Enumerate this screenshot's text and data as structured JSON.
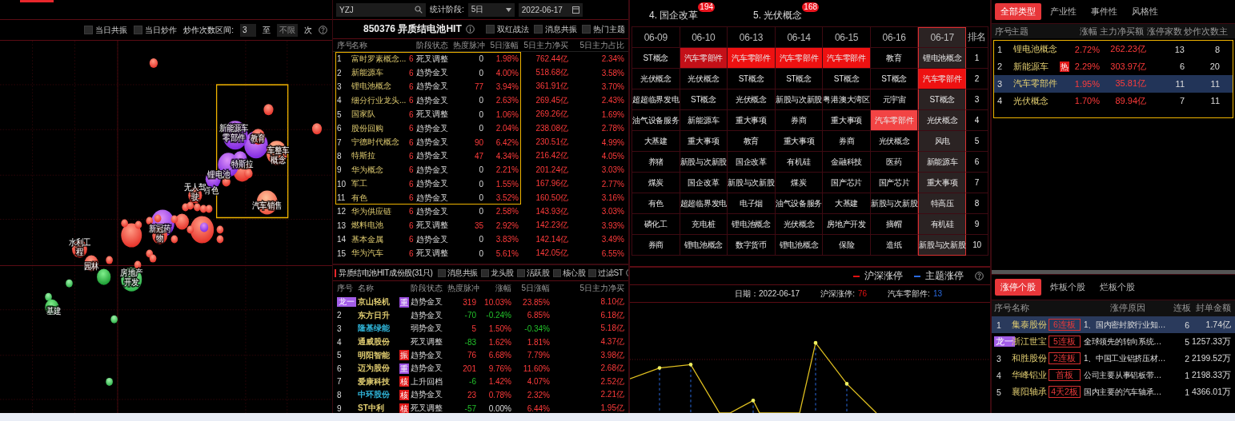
{
  "bubble_panel": {
    "options": [
      {
        "label": "当日共振",
        "checked": false
      },
      {
        "label": "当日炒作",
        "checked": false
      }
    ],
    "range_label": "炒作次数区间:",
    "range_from": "3",
    "range_sep": "至",
    "range_to_placeholder": "不限",
    "range_unit": "次",
    "bubble_labels": [
      "新能源车零部件",
      "教育",
      "车整车概念",
      "特斯拉",
      "锂电池",
      "有色",
      "汽车销售",
      "无人驾驶",
      "新冠药物",
      "水利工程",
      "园林",
      "房地产开发",
      "基建"
    ]
  },
  "toolbar": {
    "search": "YZJ",
    "period_label": "统计阶段:",
    "period": "5日",
    "date": "2022-06-17"
  },
  "theme_table": {
    "title": "850376 异质结电池HIT",
    "options": [
      {
        "label": "双红战法",
        "checked": false
      },
      {
        "label": "消息共振",
        "checked": false
      },
      {
        "label": "热门主题",
        "checked": false
      }
    ],
    "columns": [
      "序号",
      "名称",
      "阶段状态",
      "热度脉冲",
      "5日涨幅",
      "5日主力净买",
      "5日主力占比"
    ],
    "rows": [
      {
        "no": "1",
        "name": "富时罗素概念...",
        "count": "6",
        "stage": "死叉调整",
        "heat": "0",
        "change_5d": "1.98%",
        "net_buy_5d": "762.44亿",
        "ratio_5d": "2.34%",
        "framed": true
      },
      {
        "no": "2",
        "name": "新能源车",
        "count": "6",
        "stage": "趋势金叉",
        "heat": "0",
        "change_5d": "4.00%",
        "net_buy_5d": "518.68亿",
        "ratio_5d": "3.58%",
        "framed": true
      },
      {
        "no": "3",
        "name": "锂电池概念",
        "count": "6",
        "stage": "趋势金叉",
        "heat": "77",
        "change_5d": "3.94%",
        "net_buy_5d": "361.91亿",
        "ratio_5d": "3.70%",
        "framed": true
      },
      {
        "no": "4",
        "name": "细分行业龙头...",
        "count": "6",
        "stage": "趋势金叉",
        "heat": "0",
        "change_5d": "2.63%",
        "net_buy_5d": "269.45亿",
        "ratio_5d": "2.43%",
        "framed": true
      },
      {
        "no": "5",
        "name": "国家队",
        "count": "6",
        "stage": "死叉调整",
        "heat": "0",
        "change_5d": "1.06%",
        "net_buy_5d": "269.26亿",
        "ratio_5d": "1.69%",
        "framed": true
      },
      {
        "no": "6",
        "name": "股份回购",
        "count": "6",
        "stage": "趋势金叉",
        "heat": "0",
        "change_5d": "2.04%",
        "net_buy_5d": "238.08亿",
        "ratio_5d": "2.78%",
        "framed": true
      },
      {
        "no": "7",
        "name": "宁德时代概念",
        "count": "6",
        "stage": "趋势金叉",
        "heat": "90",
        "change_5d": "6.42%",
        "net_buy_5d": "230.51亿",
        "ratio_5d": "4.99%",
        "framed": true
      },
      {
        "no": "8",
        "name": "特斯拉",
        "count": "6",
        "stage": "趋势金叉",
        "heat": "47",
        "change_5d": "4.34%",
        "net_buy_5d": "216.42亿",
        "ratio_5d": "4.05%",
        "framed": true
      },
      {
        "no": "9",
        "name": "华为概念",
        "count": "6",
        "stage": "趋势金叉",
        "heat": "0",
        "change_5d": "2.21%",
        "net_buy_5d": "201.24亿",
        "ratio_5d": "3.03%",
        "framed": true
      },
      {
        "no": "10",
        "name": "军工",
        "count": "6",
        "stage": "趋势金叉",
        "heat": "0",
        "change_5d": "1.55%",
        "net_buy_5d": "167.96亿",
        "ratio_5d": "2.77%",
        "framed": true
      },
      {
        "no": "11",
        "name": "有色",
        "count": "6",
        "stage": "趋势金叉",
        "heat": "0",
        "change_5d": "3.52%",
        "net_buy_5d": "160.50亿",
        "ratio_5d": "3.16%",
        "framed": true
      },
      {
        "no": "12",
        "name": "华为供应链",
        "count": "6",
        "stage": "趋势金叉",
        "heat": "0",
        "change_5d": "2.58%",
        "net_buy_5d": "143.93亿",
        "ratio_5d": "3.03%",
        "framed": false
      },
      {
        "no": "13",
        "name": "燃料电池",
        "count": "6",
        "stage": "死叉调整",
        "heat": "35",
        "change_5d": "2.92%",
        "net_buy_5d": "142.23亿",
        "ratio_5d": "3.93%",
        "framed": false
      },
      {
        "no": "14",
        "name": "基本金属",
        "count": "6",
        "stage": "趋势金叉",
        "heat": "0",
        "change_5d": "3.83%",
        "net_buy_5d": "142.14亿",
        "ratio_5d": "3.49%",
        "framed": false
      },
      {
        "no": "15",
        "name": "华为汽车",
        "count": "6",
        "stage": "死叉调整",
        "heat": "0",
        "change_5d": "5.61%",
        "net_buy_5d": "142.05亿",
        "ratio_5d": "6.55%",
        "framed": false
      }
    ]
  },
  "component_table": {
    "title": "异质结电池HIT成份股(31只)",
    "options": [
      {
        "label": "消息共振",
        "checked": false
      },
      {
        "label": "龙头股",
        "checked": false
      },
      {
        "label": "活跃股",
        "checked": false
      },
      {
        "label": "核心股",
        "checked": false
      },
      {
        "label": "过滤ST",
        "checked": false
      }
    ],
    "columns": [
      "序号",
      "名称",
      "阶段状态",
      "热度脉冲",
      "涨幅",
      "5日涨幅",
      "5日主力净买"
    ],
    "rows": [
      {
        "no": "龙一",
        "kind": "badge",
        "name": "京山轻机",
        "color": "#e0cc70",
        "tag": {
          "text": "重",
          "color": "#9b4de0"
        },
        "stage": "趋势金叉",
        "heat": "319",
        "change": "10.03%",
        "change_5d": "23.85%",
        "net_buy_5d": "8.10亿"
      },
      {
        "no": "2",
        "kind": "plain",
        "name": "东方日升",
        "color": "#e0cc70",
        "stage": "趋势金叉",
        "heat": "-70",
        "change": "-0.24%",
        "change_5d": "6.85%",
        "net_buy_5d": "6.18亿"
      },
      {
        "no": "3",
        "kind": "plain",
        "name": "隆基绿能",
        "color": "#2fb4d8",
        "stage": "弱势金叉",
        "heat": "5",
        "change": "1.50%",
        "change_5d": "-0.34%",
        "net_buy_5d": "5.18亿"
      },
      {
        "no": "4",
        "kind": "plain",
        "name": "通威股份",
        "color": "#e0cc70",
        "stage": "死叉调整",
        "heat": "-83",
        "change": "1.62%",
        "change_5d": "1.81%",
        "net_buy_5d": "4.37亿"
      },
      {
        "no": "5",
        "kind": "plain",
        "name": "明阳智能",
        "color": "#e0cc70",
        "tag": {
          "text": "振",
          "color": "#e01818"
        },
        "stage": "趋势金叉",
        "heat": "76",
        "change": "6.68%",
        "change_5d": "7.79%",
        "net_buy_5d": "3.98亿"
      },
      {
        "no": "6",
        "kind": "plain",
        "name": "迈为股份",
        "color": "#e0cc70",
        "tag": {
          "text": "重",
          "color": "#9b4de0"
        },
        "stage": "趋势金叉",
        "heat": "201",
        "change": "9.76%",
        "change_5d": "11.60%",
        "net_buy_5d": "2.68亿"
      },
      {
        "no": "7",
        "kind": "plain",
        "name": "爱康科技",
        "color": "#e0cc70",
        "tag": {
          "text": "核",
          "color": "#e01818"
        },
        "stage": "上升回档",
        "heat": "-6",
        "change": "1.42%",
        "change_5d": "4.07%",
        "net_buy_5d": "2.52亿"
      },
      {
        "no": "8",
        "kind": "plain",
        "name": "中环股份",
        "color": "#2fb4d8",
        "tag": {
          "text": "核",
          "color": "#e01818"
        },
        "stage": "趋势金叉",
        "heat": "23",
        "change": "0.78%",
        "change_5d": "2.32%",
        "net_buy_5d": "2.21亿"
      },
      {
        "no": "9",
        "kind": "plain",
        "name": "ST中利",
        "color": "#e0cc70",
        "tag": {
          "text": "核",
          "color": "#e01818"
        },
        "stage": "死叉调整",
        "heat": "-57",
        "change": "0.00%",
        "change_5d": "6.44%",
        "net_buy_5d": "1.95亿"
      }
    ]
  },
  "top_themes": [
    {
      "label": "4. 国企改革",
      "count": "194"
    },
    {
      "label": "5. 光伏概念",
      "count": "168"
    }
  ],
  "ranking_grid": {
    "columns": [
      {
        "label": "06-09",
        "selected": false
      },
      {
        "label": "06-10",
        "selected": false
      },
      {
        "label": "06-13",
        "selected": false
      },
      {
        "label": "06-14",
        "selected": false
      },
      {
        "label": "06-15",
        "selected": false
      },
      {
        "label": "06-16",
        "selected": false
      },
      {
        "label": "06-17",
        "selected": true
      }
    ],
    "rank_header": "排名",
    "rows": [
      {
        "rank": "1",
        "cells": [
          {
            "text": "ST概念"
          },
          {
            "text": "汽车零部件",
            "color": "#c41018"
          },
          {
            "text": "汽车零部件",
            "color": "#ee1111"
          },
          {
            "text": "汽车零部件",
            "color": "#ee1111"
          },
          {
            "text": "汽车零部件",
            "color": "#ee1111"
          },
          {
            "text": "教育"
          },
          {
            "text": "锂电池概念"
          }
        ]
      },
      {
        "rank": "2",
        "cells": [
          {
            "text": "光伏概念"
          },
          {
            "text": "光伏概念"
          },
          {
            "text": "ST概念"
          },
          {
            "text": "ST概念"
          },
          {
            "text": "ST概念"
          },
          {
            "text": "ST概念"
          },
          {
            "text": "汽车零部件",
            "color": "#ee1111"
          }
        ]
      },
      {
        "rank": "3",
        "cells": [
          {
            "text": "超超临界发电"
          },
          {
            "text": "ST概念"
          },
          {
            "text": "光伏概念"
          },
          {
            "text": "新股与次新股"
          },
          {
            "text": "粤港澳大湾区"
          },
          {
            "text": "元宇宙"
          },
          {
            "text": "ST概念"
          }
        ]
      },
      {
        "rank": "4",
        "cells": [
          {
            "text": "油气设备服务"
          },
          {
            "text": "新能源车"
          },
          {
            "text": "重大事项"
          },
          {
            "text": "券商"
          },
          {
            "text": "重大事项"
          },
          {
            "text": "汽车零部件",
            "color": "#f24444"
          },
          {
            "text": "光伏概念"
          }
        ]
      },
      {
        "rank": "5",
        "cells": [
          {
            "text": "大基建"
          },
          {
            "text": "重大事项"
          },
          {
            "text": "教育"
          },
          {
            "text": "重大事项"
          },
          {
            "text": "券商"
          },
          {
            "text": "光伏概念"
          },
          {
            "text": "风电"
          }
        ]
      },
      {
        "rank": "6",
        "cells": [
          {
            "text": "养猪"
          },
          {
            "text": "新股与次新股"
          },
          {
            "text": "国企改革"
          },
          {
            "text": "有机硅"
          },
          {
            "text": "金融科技"
          },
          {
            "text": "医药"
          },
          {
            "text": "新能源车"
          }
        ]
      },
      {
        "rank": "7",
        "cells": [
          {
            "text": "煤炭"
          },
          {
            "text": "国企改革"
          },
          {
            "text": "新股与次新股"
          },
          {
            "text": "煤炭"
          },
          {
            "text": "国产芯片"
          },
          {
            "text": "国产芯片"
          },
          {
            "text": "重大事项"
          }
        ]
      },
      {
        "rank": "8",
        "cells": [
          {
            "text": "有色"
          },
          {
            "text": "超超临界发电"
          },
          {
            "text": "电子烟"
          },
          {
            "text": "油气设备服务"
          },
          {
            "text": "大基建"
          },
          {
            "text": "新股与次新股"
          },
          {
            "text": "特高压"
          }
        ]
      },
      {
        "rank": "9",
        "cells": [
          {
            "text": "磷化工"
          },
          {
            "text": "充电桩"
          },
          {
            "text": "锂电池概念"
          },
          {
            "text": "光伏概念"
          },
          {
            "text": "房地产开发"
          },
          {
            "text": "摘帽"
          },
          {
            "text": "有机硅"
          }
        ]
      },
      {
        "rank": "10",
        "cells": [
          {
            "text": "券商"
          },
          {
            "text": "锂电池概念"
          },
          {
            "text": "数字货币"
          },
          {
            "text": "锂电池概念"
          },
          {
            "text": "保险"
          },
          {
            "text": "造纸"
          },
          {
            "text": "新股与次新股"
          }
        ]
      }
    ]
  },
  "limit_chart": {
    "legend": [
      {
        "label": "沪深涨停",
        "color": "#e01010"
      },
      {
        "label": "主题涨停",
        "color": "#2a6ae0"
      }
    ],
    "date": "日期：2022-06-17",
    "market_label": "沪深涨停:",
    "market_value": "76",
    "theme_label": "汽车零部件:",
    "theme_value": "13"
  },
  "type_tabs": [
    {
      "label": "全部类型",
      "selected": true
    },
    {
      "label": "产业性",
      "selected": false
    },
    {
      "label": "事件性",
      "selected": false
    },
    {
      "label": "风格性",
      "selected": false
    }
  ],
  "theme_list": {
    "columns": [
      "序号",
      "主题",
      "涨幅",
      "主力净买额",
      "涨停家数",
      "炒作次数",
      "主"
    ],
    "rows": [
      {
        "no": "1",
        "name": "锂电池概念",
        "change": "2.72%",
        "net_buy": "262.23亿",
        "limit_up": "13",
        "hype": "8",
        "selected": false
      },
      {
        "no": "2",
        "name": "新能源车",
        "badge": "热",
        "change": "2.29%",
        "net_buy": "303.97亿",
        "limit_up": "6",
        "hype": "20",
        "selected": false
      },
      {
        "no": "3",
        "name": "汽车零部件",
        "change": "1.95%",
        "net_buy": "35.81亿",
        "limit_up": "11",
        "hype": "11",
        "selected": true
      },
      {
        "no": "4",
        "name": "光伏概念",
        "change": "1.70%",
        "net_buy": "89.94亿",
        "limit_up": "7",
        "hype": "11",
        "selected": false
      }
    ]
  },
  "stock_tabs": [
    {
      "label": "涨停个股",
      "selected": true
    },
    {
      "label": "炸板个股",
      "selected": false
    },
    {
      "label": "烂板个股",
      "selected": false
    }
  ],
  "limit_up_list": {
    "columns": [
      "序号",
      "名称",
      "涨停原因",
      "连板",
      "封单金额"
    ],
    "rows": [
      {
        "no": "1",
        "kind": "plain",
        "name": "集泰股份",
        "board": "6连板",
        "reason": "1、国内密封胶行业知…",
        "streak": "6",
        "seal": "1.74亿",
        "selected": true
      },
      {
        "no": "龙一",
        "kind": "badge",
        "name": "浙江世宝",
        "board": "5连板",
        "reason": "全球领先的转向系统…",
        "streak": "5",
        "seal": "1257.33万",
        "selected": false
      },
      {
        "no": "3",
        "kind": "plain",
        "name": "和胜股份",
        "board": "2连板",
        "reason": "1、中国工业铝挤压材…",
        "streak": "2",
        "seal": "2199.52万",
        "selected": false
      },
      {
        "no": "4",
        "kind": "plain",
        "name": "华峰铝业",
        "board": "首板",
        "reason": "公司主要从事铝板带…",
        "streak": "1",
        "seal": "2198.33万",
        "selected": false
      },
      {
        "no": "5",
        "kind": "plain",
        "name": "襄阳轴承",
        "board": "4天2板",
        "reason": "国内主要的汽车轴承…",
        "streak": "1",
        "seal": "4366.01万",
        "selected": false
      }
    ]
  }
}
